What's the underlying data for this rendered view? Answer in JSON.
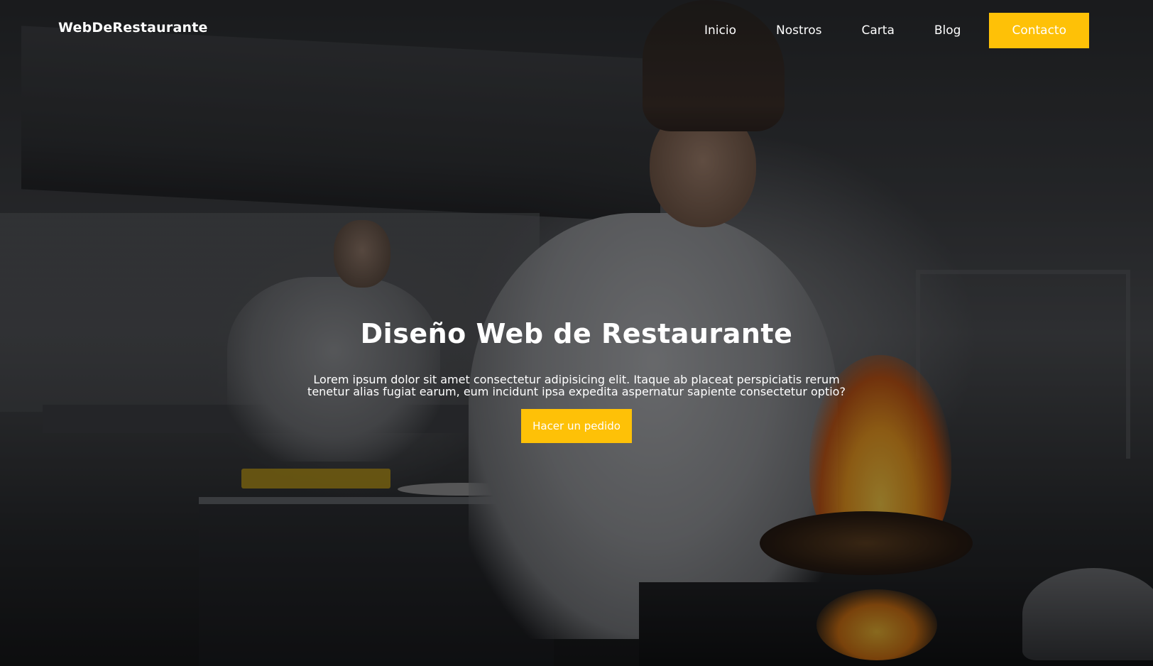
{
  "header": {
    "logo": "WebDeRestaurante",
    "nav": {
      "inicio": "Inicio",
      "nosotros": "Nostros",
      "carta": "Carta",
      "blog": "Blog",
      "contacto": "Contacto"
    }
  },
  "hero": {
    "title": "Diseño Web de Restaurante",
    "description": "Lorem ipsum dolor sit amet consectetur adipisicing elit. Itaque ab placeat perspiciatis rerum tenetur alias fugiat earum, eum incidunt ipsa expedita aspernatur sapiente consectetur optio?",
    "order_button": "Hacer un pedido"
  },
  "colors": {
    "accent": "#fec107",
    "text": "#ffffff",
    "overlay": "rgba(0,0,0,0.38)"
  }
}
